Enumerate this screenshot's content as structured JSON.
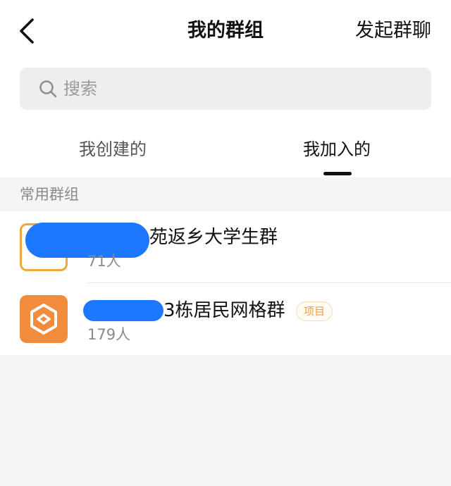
{
  "header": {
    "title": "我的群组",
    "action_label": "发起群聊"
  },
  "search": {
    "placeholder": "搜索"
  },
  "tabs": [
    {
      "label": "我创建的",
      "active": false
    },
    {
      "label": "我加入的",
      "active": true
    }
  ],
  "section": {
    "title": "常用群组"
  },
  "groups": [
    {
      "name_visible": "苑返乡大学生群",
      "member_count": "71人"
    },
    {
      "name_visible": "3栋居民网格群",
      "member_count": "179人",
      "badge": "项目"
    }
  ],
  "colors": {
    "accent": "#1e78ff",
    "avatar_orange": "#f08c3b",
    "avatar_border": "#f0a63a",
    "badge_text": "#e7a24b"
  }
}
